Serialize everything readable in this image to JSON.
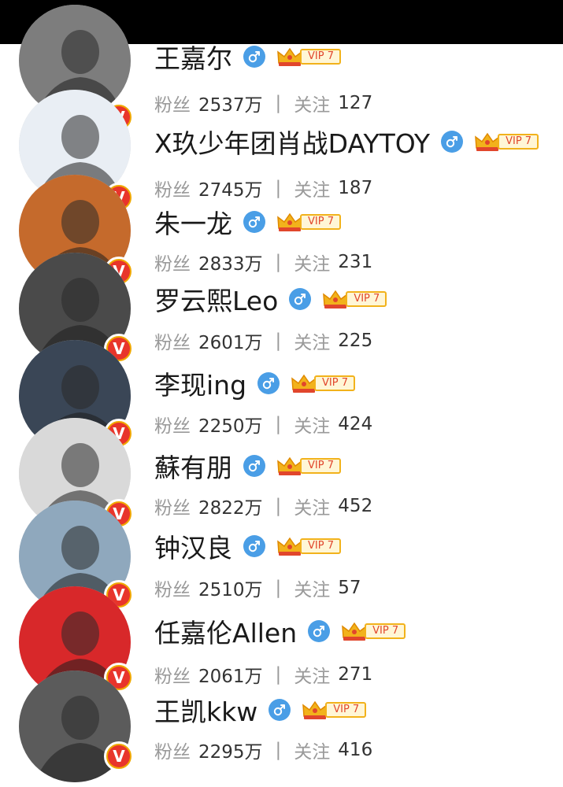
{
  "rows": [
    {
      "name": "王嘉尔",
      "fans_label": "粉丝",
      "fans": "2537万",
      "sep": "|",
      "follow_label": "关注",
      "follow": "127",
      "vip": "VIP 7",
      "avatar_theme": "#7d7d7d"
    },
    {
      "name": "X玖少年团肖战DAYTOY",
      "fans_label": "粉丝",
      "fans": "2745万",
      "sep": "|",
      "follow_label": "关注",
      "follow": "187",
      "vip": "VIP 7",
      "avatar_theme": "#e9eef4"
    },
    {
      "name": "朱一龙",
      "fans_label": "粉丝",
      "fans": "2833万",
      "sep": "|",
      "follow_label": "关注",
      "follow": "231",
      "vip": "VIP 7",
      "avatar_theme": "#c56a2c"
    },
    {
      "name": "罗云熙Leo",
      "fans_label": "粉丝",
      "fans": "2601万",
      "sep": "|",
      "follow_label": "关注",
      "follow": "225",
      "vip": "VIP 7",
      "avatar_theme": "#4a4a4a"
    },
    {
      "name": "李现ing",
      "fans_label": "粉丝",
      "fans": "2250万",
      "sep": "|",
      "follow_label": "关注",
      "follow": "424",
      "vip": "VIP 7",
      "avatar_theme": "#3a4656"
    },
    {
      "name": "蘇有朋",
      "fans_label": "粉丝",
      "fans": "2822万",
      "sep": "|",
      "follow_label": "关注",
      "follow": "452",
      "vip": "VIP 7",
      "avatar_theme": "#d9d9d9"
    },
    {
      "name": "钟汉良",
      "fans_label": "粉丝",
      "fans": "2510万",
      "sep": "|",
      "follow_label": "关注",
      "follow": "57",
      "vip": "VIP 7",
      "avatar_theme": "#8fa8bd"
    },
    {
      "name": "任嘉伦Allen",
      "fans_label": "粉丝",
      "fans": "2061万",
      "sep": "|",
      "follow_label": "关注",
      "follow": "271",
      "vip": "VIP 7",
      "avatar_theme": "#d8282a"
    },
    {
      "name": "王凯kkw",
      "fans_label": "粉丝",
      "fans": "2295万",
      "sep": "|",
      "follow_label": "关注",
      "follow": "416",
      "vip": "VIP 7",
      "avatar_theme": "#5b5b5b"
    }
  ],
  "badge_letter": "V",
  "colors": {
    "verified_gold": "#f0a800",
    "verified_red": "#e8352b",
    "male_blue": "#4a9ee6",
    "vip_red": "#e1462c",
    "vip_gold": "#f2b21b"
  }
}
